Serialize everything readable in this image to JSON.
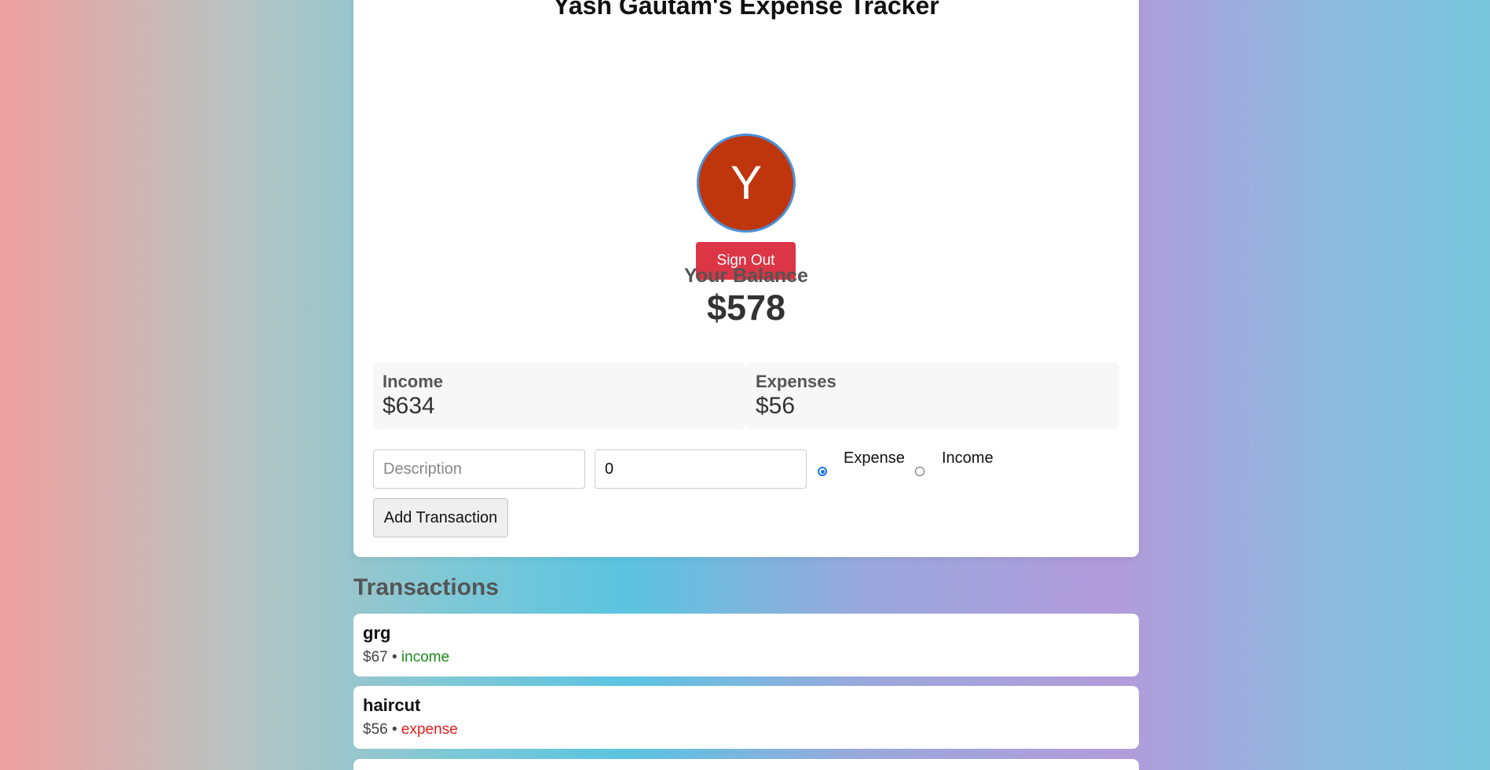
{
  "app": {
    "title": "Yash Gautam's Expense Tracker"
  },
  "user": {
    "avatar_initial": "Y",
    "avatar_color": "#bf360c"
  },
  "actions": {
    "sign_out_label": "Sign Out",
    "sign_out_color": "#dc3545"
  },
  "balance": {
    "label": "Your Balance",
    "value": "$578"
  },
  "summary": {
    "income_label": "Income",
    "income_value": "$634",
    "expenses_label": "Expenses",
    "expenses_value": "$56"
  },
  "form": {
    "description_placeholder": "Description",
    "amount_value": "0",
    "type_options": [
      "Expense",
      "Income"
    ],
    "selected_type": "Expense",
    "submit_label": "Add Transaction"
  },
  "transactions": {
    "heading": "Transactions",
    "items": [
      {
        "description": "grg",
        "amount": "$67",
        "separator": "•",
        "type": "income",
        "type_color": "#1a8a1a"
      },
      {
        "description": "haircut",
        "amount": "$56",
        "separator": "•",
        "type": "expense",
        "type_color": "#e51e1e"
      }
    ]
  }
}
